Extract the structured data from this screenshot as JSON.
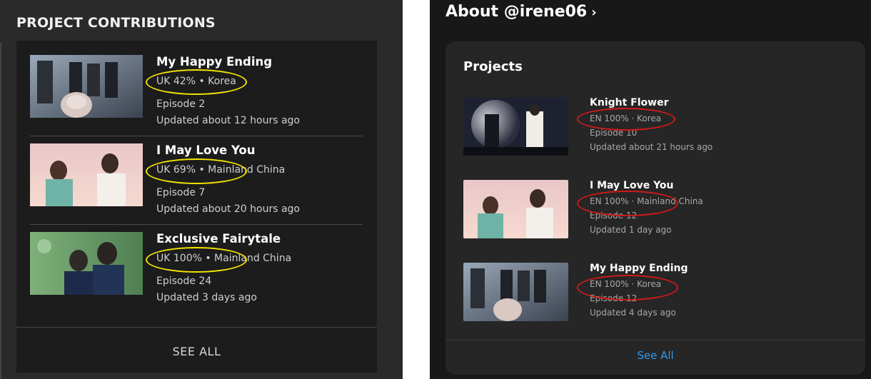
{
  "left": {
    "title": "PROJECT CONTRIBUTIONS",
    "items": [
      {
        "title": "My Happy Ending",
        "meta": "UK 42% • Korea",
        "episode": "Episode 2",
        "updated": "Updated about 12 hours ago"
      },
      {
        "title": "I May Love You",
        "meta": "UK 69% • Mainland China",
        "episode": "Episode 7",
        "updated": "Updated about 20 hours ago"
      },
      {
        "title": "Exclusive Fairytale",
        "meta": "UK 100% • Mainland China",
        "episode": "Episode 24",
        "updated": "Updated 3 days ago"
      }
    ],
    "see_all": "SEE ALL"
  },
  "right": {
    "about": "About @irene06",
    "chevron": "›",
    "projects_heading": "Projects",
    "items": [
      {
        "title": "Knight Flower",
        "meta": "EN 100% · Korea",
        "episode": "Episode 10",
        "updated": "Updated about 21 hours ago"
      },
      {
        "title": "I May Love You",
        "meta": "EN 100% · Mainland China",
        "episode": "Episode 12",
        "updated": "Updated 1 day ago"
      },
      {
        "title": "My Happy Ending",
        "meta": "EN 100% · Korea",
        "episode": "Episode 12",
        "updated": "Updated 4 days ago"
      }
    ],
    "see_all": "See All"
  },
  "colors": {
    "highlight_left": "#f4e400",
    "highlight_right": "#d11a1a",
    "link": "#2d9bf0"
  },
  "icons": {
    "chevron": "chevron-right-icon"
  }
}
